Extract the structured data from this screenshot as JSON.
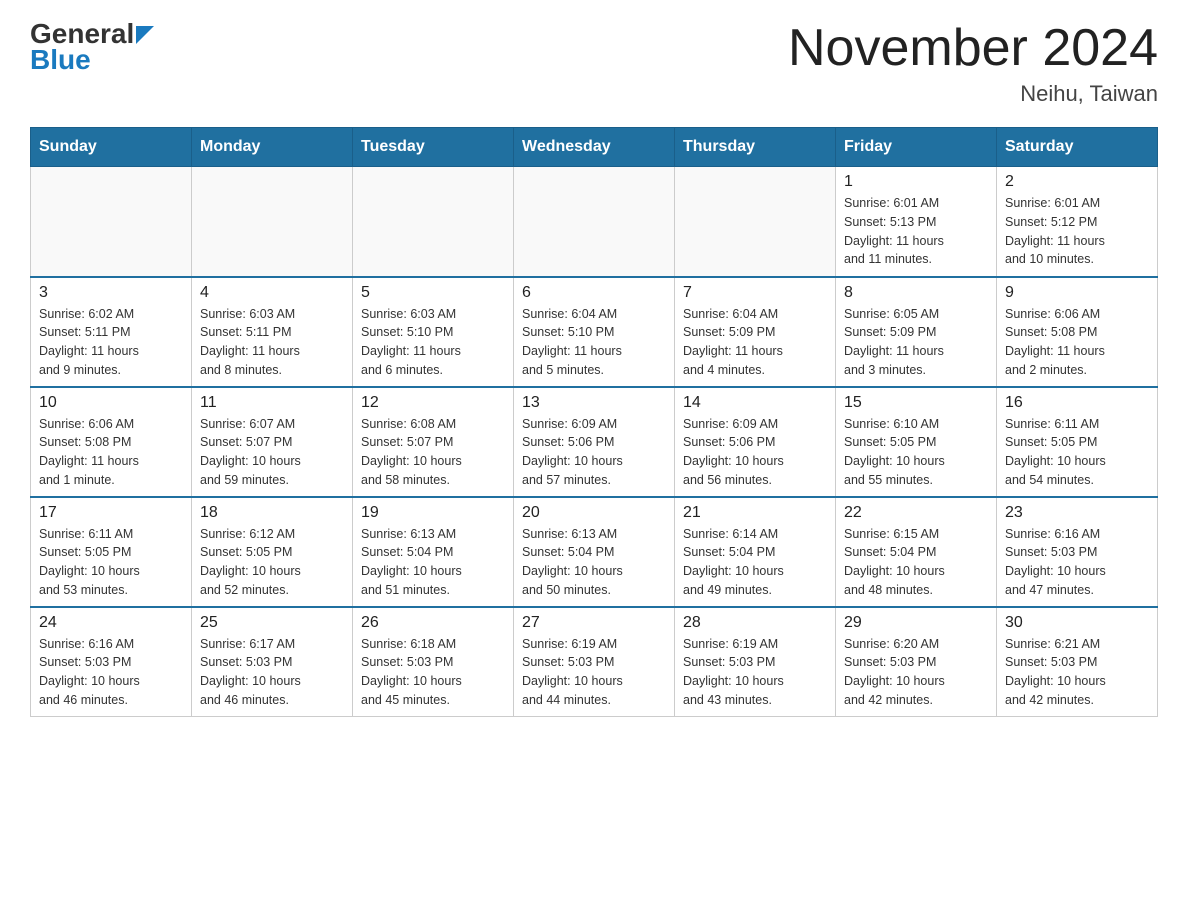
{
  "header": {
    "logo_general": "General",
    "logo_blue": "Blue",
    "month_title": "November 2024",
    "location": "Neihu, Taiwan"
  },
  "weekdays": [
    "Sunday",
    "Monday",
    "Tuesday",
    "Wednesday",
    "Thursday",
    "Friday",
    "Saturday"
  ],
  "weeks": [
    [
      {
        "day": "",
        "info": ""
      },
      {
        "day": "",
        "info": ""
      },
      {
        "day": "",
        "info": ""
      },
      {
        "day": "",
        "info": ""
      },
      {
        "day": "",
        "info": ""
      },
      {
        "day": "1",
        "info": "Sunrise: 6:01 AM\nSunset: 5:13 PM\nDaylight: 11 hours\nand 11 minutes."
      },
      {
        "day": "2",
        "info": "Sunrise: 6:01 AM\nSunset: 5:12 PM\nDaylight: 11 hours\nand 10 minutes."
      }
    ],
    [
      {
        "day": "3",
        "info": "Sunrise: 6:02 AM\nSunset: 5:11 PM\nDaylight: 11 hours\nand 9 minutes."
      },
      {
        "day": "4",
        "info": "Sunrise: 6:03 AM\nSunset: 5:11 PM\nDaylight: 11 hours\nand 8 minutes."
      },
      {
        "day": "5",
        "info": "Sunrise: 6:03 AM\nSunset: 5:10 PM\nDaylight: 11 hours\nand 6 minutes."
      },
      {
        "day": "6",
        "info": "Sunrise: 6:04 AM\nSunset: 5:10 PM\nDaylight: 11 hours\nand 5 minutes."
      },
      {
        "day": "7",
        "info": "Sunrise: 6:04 AM\nSunset: 5:09 PM\nDaylight: 11 hours\nand 4 minutes."
      },
      {
        "day": "8",
        "info": "Sunrise: 6:05 AM\nSunset: 5:09 PM\nDaylight: 11 hours\nand 3 minutes."
      },
      {
        "day": "9",
        "info": "Sunrise: 6:06 AM\nSunset: 5:08 PM\nDaylight: 11 hours\nand 2 minutes."
      }
    ],
    [
      {
        "day": "10",
        "info": "Sunrise: 6:06 AM\nSunset: 5:08 PM\nDaylight: 11 hours\nand 1 minute."
      },
      {
        "day": "11",
        "info": "Sunrise: 6:07 AM\nSunset: 5:07 PM\nDaylight: 10 hours\nand 59 minutes."
      },
      {
        "day": "12",
        "info": "Sunrise: 6:08 AM\nSunset: 5:07 PM\nDaylight: 10 hours\nand 58 minutes."
      },
      {
        "day": "13",
        "info": "Sunrise: 6:09 AM\nSunset: 5:06 PM\nDaylight: 10 hours\nand 57 minutes."
      },
      {
        "day": "14",
        "info": "Sunrise: 6:09 AM\nSunset: 5:06 PM\nDaylight: 10 hours\nand 56 minutes."
      },
      {
        "day": "15",
        "info": "Sunrise: 6:10 AM\nSunset: 5:05 PM\nDaylight: 10 hours\nand 55 minutes."
      },
      {
        "day": "16",
        "info": "Sunrise: 6:11 AM\nSunset: 5:05 PM\nDaylight: 10 hours\nand 54 minutes."
      }
    ],
    [
      {
        "day": "17",
        "info": "Sunrise: 6:11 AM\nSunset: 5:05 PM\nDaylight: 10 hours\nand 53 minutes."
      },
      {
        "day": "18",
        "info": "Sunrise: 6:12 AM\nSunset: 5:05 PM\nDaylight: 10 hours\nand 52 minutes."
      },
      {
        "day": "19",
        "info": "Sunrise: 6:13 AM\nSunset: 5:04 PM\nDaylight: 10 hours\nand 51 minutes."
      },
      {
        "day": "20",
        "info": "Sunrise: 6:13 AM\nSunset: 5:04 PM\nDaylight: 10 hours\nand 50 minutes."
      },
      {
        "day": "21",
        "info": "Sunrise: 6:14 AM\nSunset: 5:04 PM\nDaylight: 10 hours\nand 49 minutes."
      },
      {
        "day": "22",
        "info": "Sunrise: 6:15 AM\nSunset: 5:04 PM\nDaylight: 10 hours\nand 48 minutes."
      },
      {
        "day": "23",
        "info": "Sunrise: 6:16 AM\nSunset: 5:03 PM\nDaylight: 10 hours\nand 47 minutes."
      }
    ],
    [
      {
        "day": "24",
        "info": "Sunrise: 6:16 AM\nSunset: 5:03 PM\nDaylight: 10 hours\nand 46 minutes."
      },
      {
        "day": "25",
        "info": "Sunrise: 6:17 AM\nSunset: 5:03 PM\nDaylight: 10 hours\nand 46 minutes."
      },
      {
        "day": "26",
        "info": "Sunrise: 6:18 AM\nSunset: 5:03 PM\nDaylight: 10 hours\nand 45 minutes."
      },
      {
        "day": "27",
        "info": "Sunrise: 6:19 AM\nSunset: 5:03 PM\nDaylight: 10 hours\nand 44 minutes."
      },
      {
        "day": "28",
        "info": "Sunrise: 6:19 AM\nSunset: 5:03 PM\nDaylight: 10 hours\nand 43 minutes."
      },
      {
        "day": "29",
        "info": "Sunrise: 6:20 AM\nSunset: 5:03 PM\nDaylight: 10 hours\nand 42 minutes."
      },
      {
        "day": "30",
        "info": "Sunrise: 6:21 AM\nSunset: 5:03 PM\nDaylight: 10 hours\nand 42 minutes."
      }
    ]
  ]
}
